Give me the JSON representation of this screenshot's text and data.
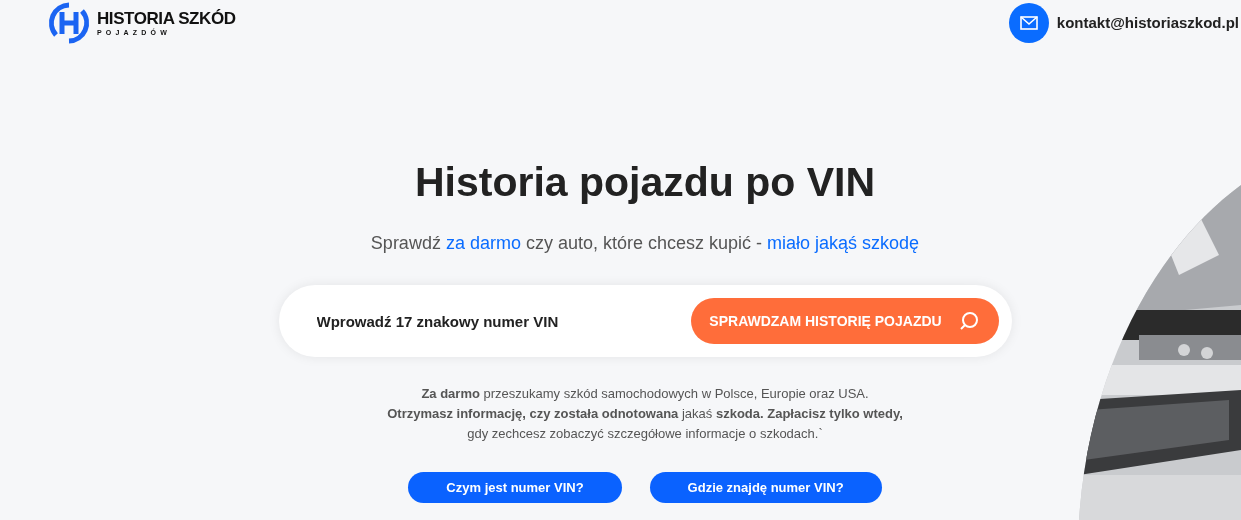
{
  "header": {
    "logo": {
      "title": "HISTORIA SZKÓD",
      "subtitle": "POJAZDÓW"
    },
    "contact_email": "kontakt@historiaszkod.pl"
  },
  "hero": {
    "title": "Historia pojazdu po VIN",
    "subtitle": [
      {
        "text": "Sprawdź ",
        "highlight": false
      },
      {
        "text": "za darmo",
        "highlight": true
      },
      {
        "text": " czy auto, które chcesz kupić - ",
        "highlight": false
      },
      {
        "text": "miało jakąś szkodę",
        "highlight": true
      }
    ],
    "search": {
      "placeholder": "Wprowadź 17 znakowy numer VIN",
      "button": "SPRAWDZAM HISTORIĘ POJAZDU"
    },
    "description": [
      "**Za darmo** przeszukamy szkód samochodowych w Polsce, Europie oraz USA.",
      "**Otrzymasz informację, czy została odnotowana** jakaś **szkoda. Zapłacisz tylko wtedy,**",
      "gdy zechcesz zobaczyć szczegółowe informacje o szkodach.`"
    ],
    "buttons": [
      "Czym jest numer VIN?",
      "Gdzie znajdę numer VIN?"
    ],
    "image": {
      "kind": "picture"
    }
  }
}
